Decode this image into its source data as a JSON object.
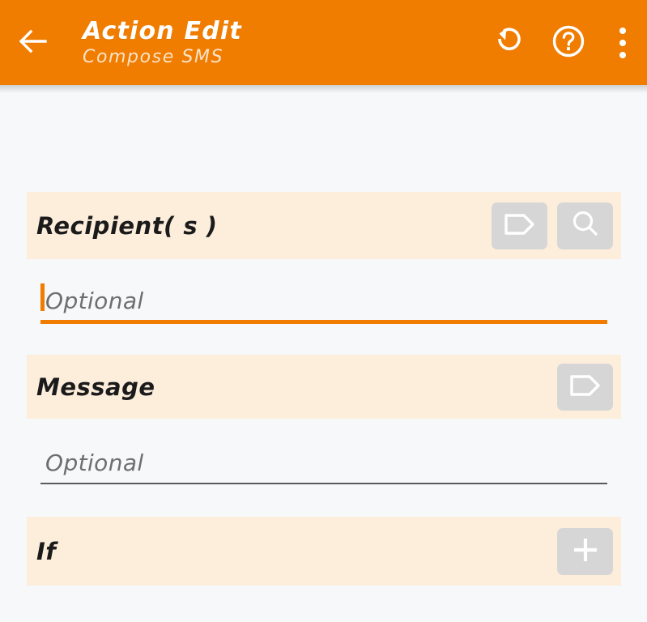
{
  "appbar": {
    "back_icon": "arrow-left-icon",
    "title": "Action Edit",
    "subtitle": "Compose SMS",
    "actions": [
      {
        "name": "undo-icon",
        "label": "Undo"
      },
      {
        "name": "help-icon",
        "label": "Help"
      },
      {
        "name": "overflow-menu-icon",
        "label": "More options"
      }
    ],
    "background_color": "#f07c00",
    "title_color": "#ffffff",
    "subtitle_color": "#fbe3c8"
  },
  "sections": [
    {
      "id": "recipients",
      "label": "Recipient( s )",
      "buttons": [
        {
          "name": "tag-icon",
          "label": "Variables"
        },
        {
          "name": "search-icon",
          "label": "Search contacts"
        }
      ]
    },
    {
      "id": "message",
      "label": "Message",
      "buttons": [
        {
          "name": "tag-icon",
          "label": "Variables"
        }
      ]
    },
    {
      "id": "if",
      "label": "If",
      "buttons": [
        {
          "name": "plus-icon",
          "label": "Add condition"
        }
      ]
    }
  ],
  "fields": [
    {
      "id": "recipients-input",
      "placeholder": "Optional",
      "value": "",
      "focused": true
    },
    {
      "id": "message-input",
      "placeholder": "Optional",
      "value": "",
      "focused": false
    }
  ],
  "colors": {
    "accent": "#f07c00",
    "section_background": "#fdeedc",
    "page_background": "#f7f8fa",
    "button_face": "#d6d6d6",
    "placeholder_text": "#6e6e6e",
    "idle_underline": "#5a5a5a"
  }
}
